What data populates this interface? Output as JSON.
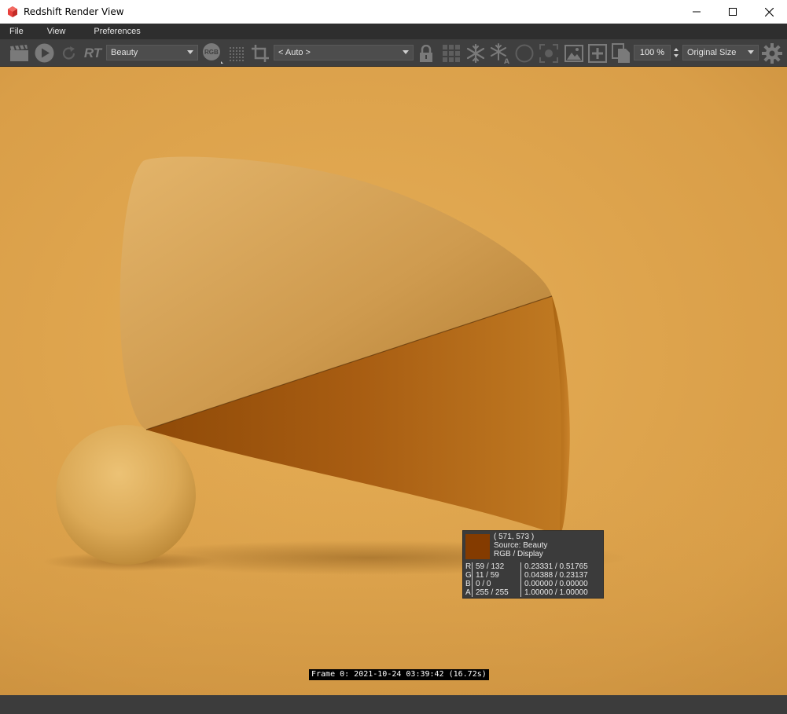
{
  "window": {
    "title": "Redshift Render View",
    "icons": [
      "redshift-logo-icon",
      "minimize-icon",
      "maximize-icon",
      "close-icon"
    ]
  },
  "menu": {
    "items": [
      "File",
      "View",
      "Preferences"
    ]
  },
  "toolbar": {
    "rt_label": "RT",
    "aov_dropdown": "Beauty",
    "rgb_label": "RGB",
    "camera_dropdown": "< Auto >",
    "zoom_value": "100 %",
    "size_dropdown": "Original Size",
    "icons": [
      "clapboard-icon",
      "play-icon",
      "refresh-icon",
      "rgb-icon",
      "dots-grid-icon",
      "crop-icon",
      "lock-icon",
      "grid-icon",
      "snowflake-icon",
      "snowflake-a-icon",
      "circle-icon",
      "focus-icon",
      "image-icon",
      "add-image-icon",
      "copy-icon",
      "settings-gear-icon"
    ]
  },
  "render": {
    "scene_colors": {
      "background": "#e0a74e",
      "cone_light": "#d9a556",
      "cone_dark": "#a55a0d",
      "sphere": "#e1ae5b"
    }
  },
  "pixel_info": {
    "coords": "( 571, 573 )",
    "source": "Source: Beauty",
    "mode": "RGB / Display",
    "swatch_color": "#843b00",
    "rows": [
      {
        "ch": "R",
        "int": "59 / 132",
        "flt": "0.23331 / 0.51765"
      },
      {
        "ch": "G",
        "int": "11 / 59",
        "flt": "0.04388 / 0.23137"
      },
      {
        "ch": "B",
        "int": "0 / 0",
        "flt": "0.00000 / 0.00000"
      },
      {
        "ch": "A",
        "int": "255 / 255",
        "flt": "1.00000 / 1.00000"
      }
    ]
  },
  "frame_info": "Frame 0: 2021-10-24 03:39:42 (16.72s)"
}
